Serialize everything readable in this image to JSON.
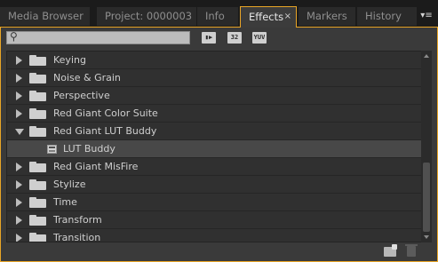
{
  "tabs": [
    {
      "label": "Media Browser"
    },
    {
      "label": "Project: 0000003"
    },
    {
      "label": "Info"
    },
    {
      "label": "Effects",
      "close": "×"
    },
    {
      "label": "Markers"
    },
    {
      "label": "History"
    }
  ],
  "panel_menu_icon": "▾≡",
  "toolbar": {
    "search": {
      "value": "",
      "placeholder": "",
      "icon": "magnifier-icon"
    },
    "buttons": [
      {
        "label": "▮▶",
        "name": "accelerated-effects-icon"
      },
      {
        "label": "32",
        "name": "32bit-effects-icon"
      },
      {
        "label": "YUV",
        "name": "yuv-effects-icon"
      }
    ]
  },
  "list": {
    "rows": [
      {
        "label": "Keying",
        "type": "folder",
        "expanded": false
      },
      {
        "label": "Noise & Grain",
        "type": "folder",
        "expanded": false
      },
      {
        "label": "Perspective",
        "type": "folder",
        "expanded": false
      },
      {
        "label": "Red Giant Color Suite",
        "type": "folder",
        "expanded": false
      },
      {
        "label": "Red Giant LUT Buddy",
        "type": "folder",
        "expanded": true
      },
      {
        "label": "LUT Buddy",
        "type": "effect",
        "selected": true
      },
      {
        "label": "Red Giant MisFire",
        "type": "folder",
        "expanded": false
      },
      {
        "label": "Stylize",
        "type": "folder",
        "expanded": false
      },
      {
        "label": "Time",
        "type": "folder",
        "expanded": false
      },
      {
        "label": "Transform",
        "type": "folder",
        "expanded": false
      },
      {
        "label": "Transition",
        "type": "folder",
        "expanded": false
      }
    ]
  },
  "colors": {
    "accent": "#e9a526",
    "panel": "#3a3a3a",
    "list": "#303030",
    "selected_row": "#484848"
  }
}
